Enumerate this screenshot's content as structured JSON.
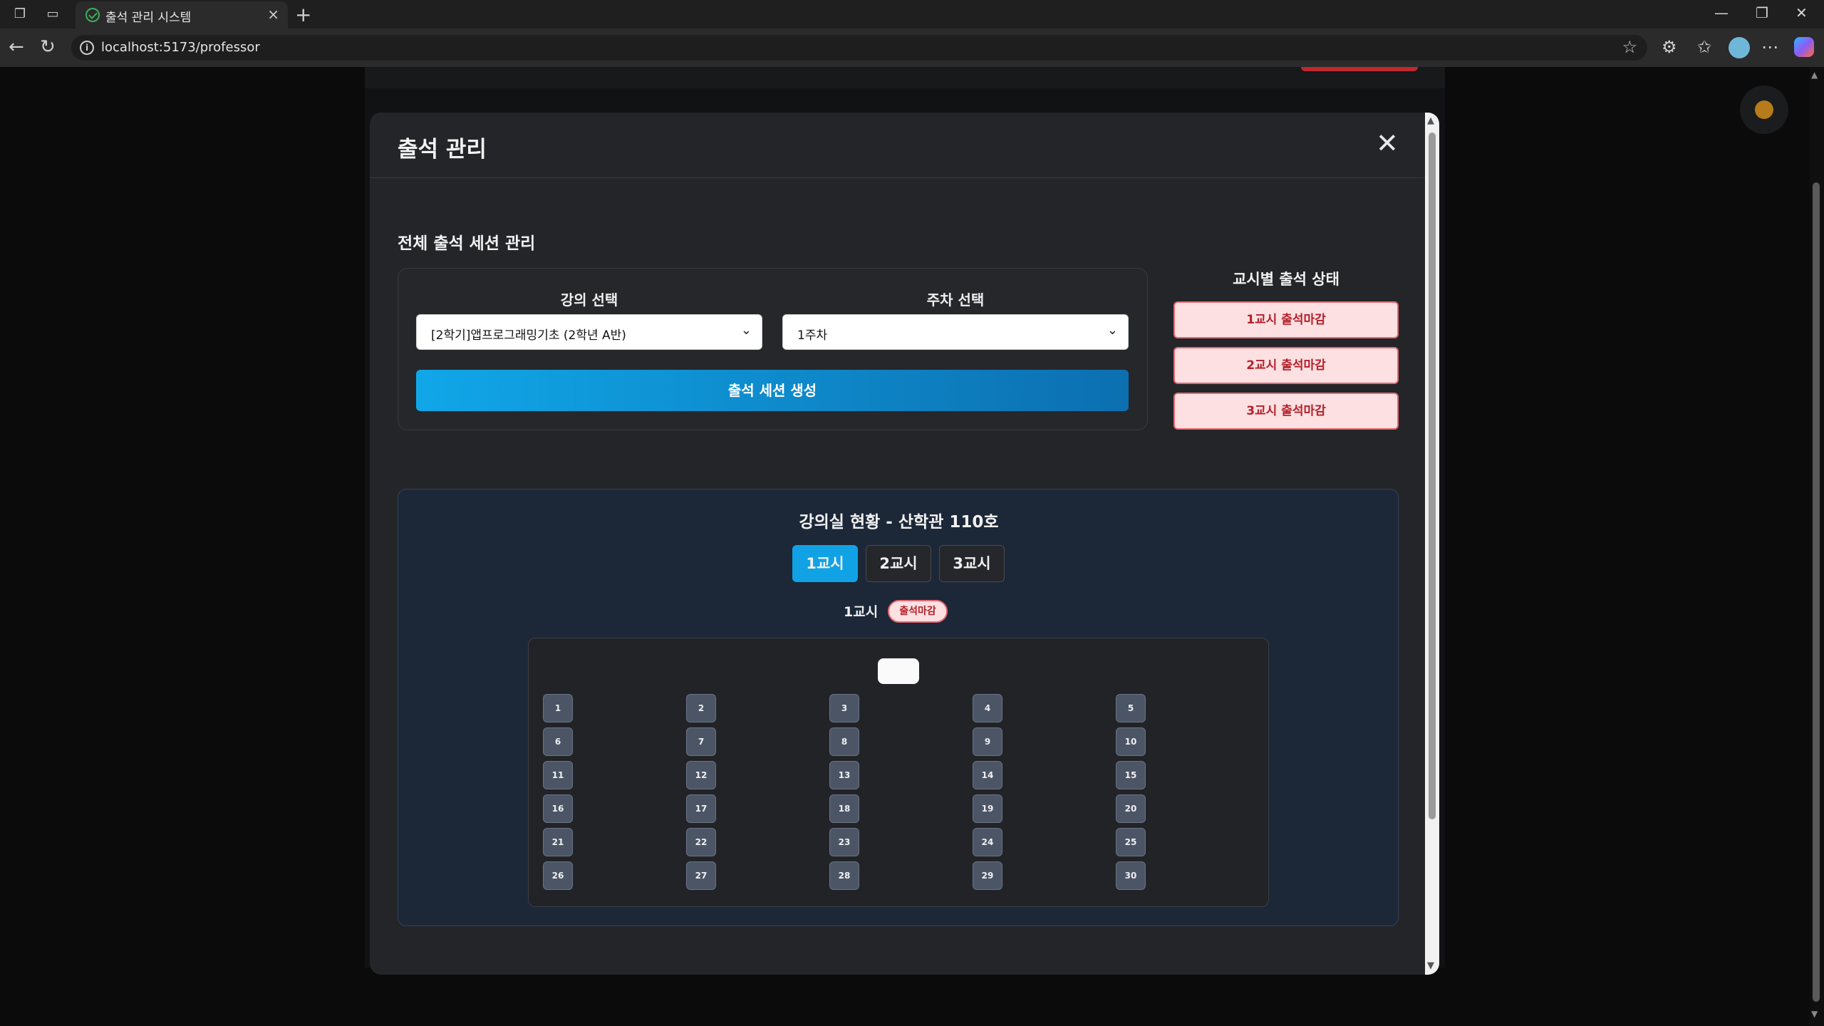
{
  "browser": {
    "tab_title": "출석 관리 시스템",
    "url": "localhost:5173/professor",
    "new_tab_symbol": "+",
    "tab_close_symbol": "×",
    "icons": [
      "workspaces-icon",
      "tab-actions-icon",
      "back-icon",
      "reload-icon",
      "info-icon",
      "favorite-star-icon",
      "extensions-icon",
      "favorites-icon",
      "profile-icon",
      "more-icon",
      "copilot-icon"
    ]
  },
  "modal": {
    "title": "출석 관리",
    "close_symbol": "✕",
    "section_title": "전체 출석 세션 관리",
    "course_label": "강의 선택",
    "course_value": "[2학기]앱프로그래밍기초 (2학년 A반)",
    "week_label": "주차 선택",
    "week_value": "1주차",
    "create_button": "출석 세션 생성",
    "status_title": "교시별 출석 상태",
    "status_buttons": [
      "1교시 출석마감",
      "2교시 출석마감",
      "3교시 출석마감"
    ],
    "room": {
      "title": "강의실 현황 - 산학관 110호",
      "period_tabs": [
        "1교시",
        "2교시",
        "3교시"
      ],
      "active_tab": "1교시",
      "current_period": "1교시",
      "current_status": "출석마감",
      "seats": [
        "1",
        "2",
        "3",
        "4",
        "5",
        "6",
        "7",
        "8",
        "9",
        "10",
        "11",
        "12",
        "13",
        "14",
        "15",
        "16",
        "17",
        "18",
        "19",
        "20",
        "21",
        "22",
        "23",
        "24",
        "25",
        "26",
        "27",
        "28",
        "29",
        "30"
      ]
    }
  },
  "colors": {
    "accent": "#10a2e4",
    "closed_badge_bg": "#fde0e2",
    "closed_badge_text": "#b3212b",
    "modal_bg": "#242529",
    "room_bg": "#1c2738"
  }
}
